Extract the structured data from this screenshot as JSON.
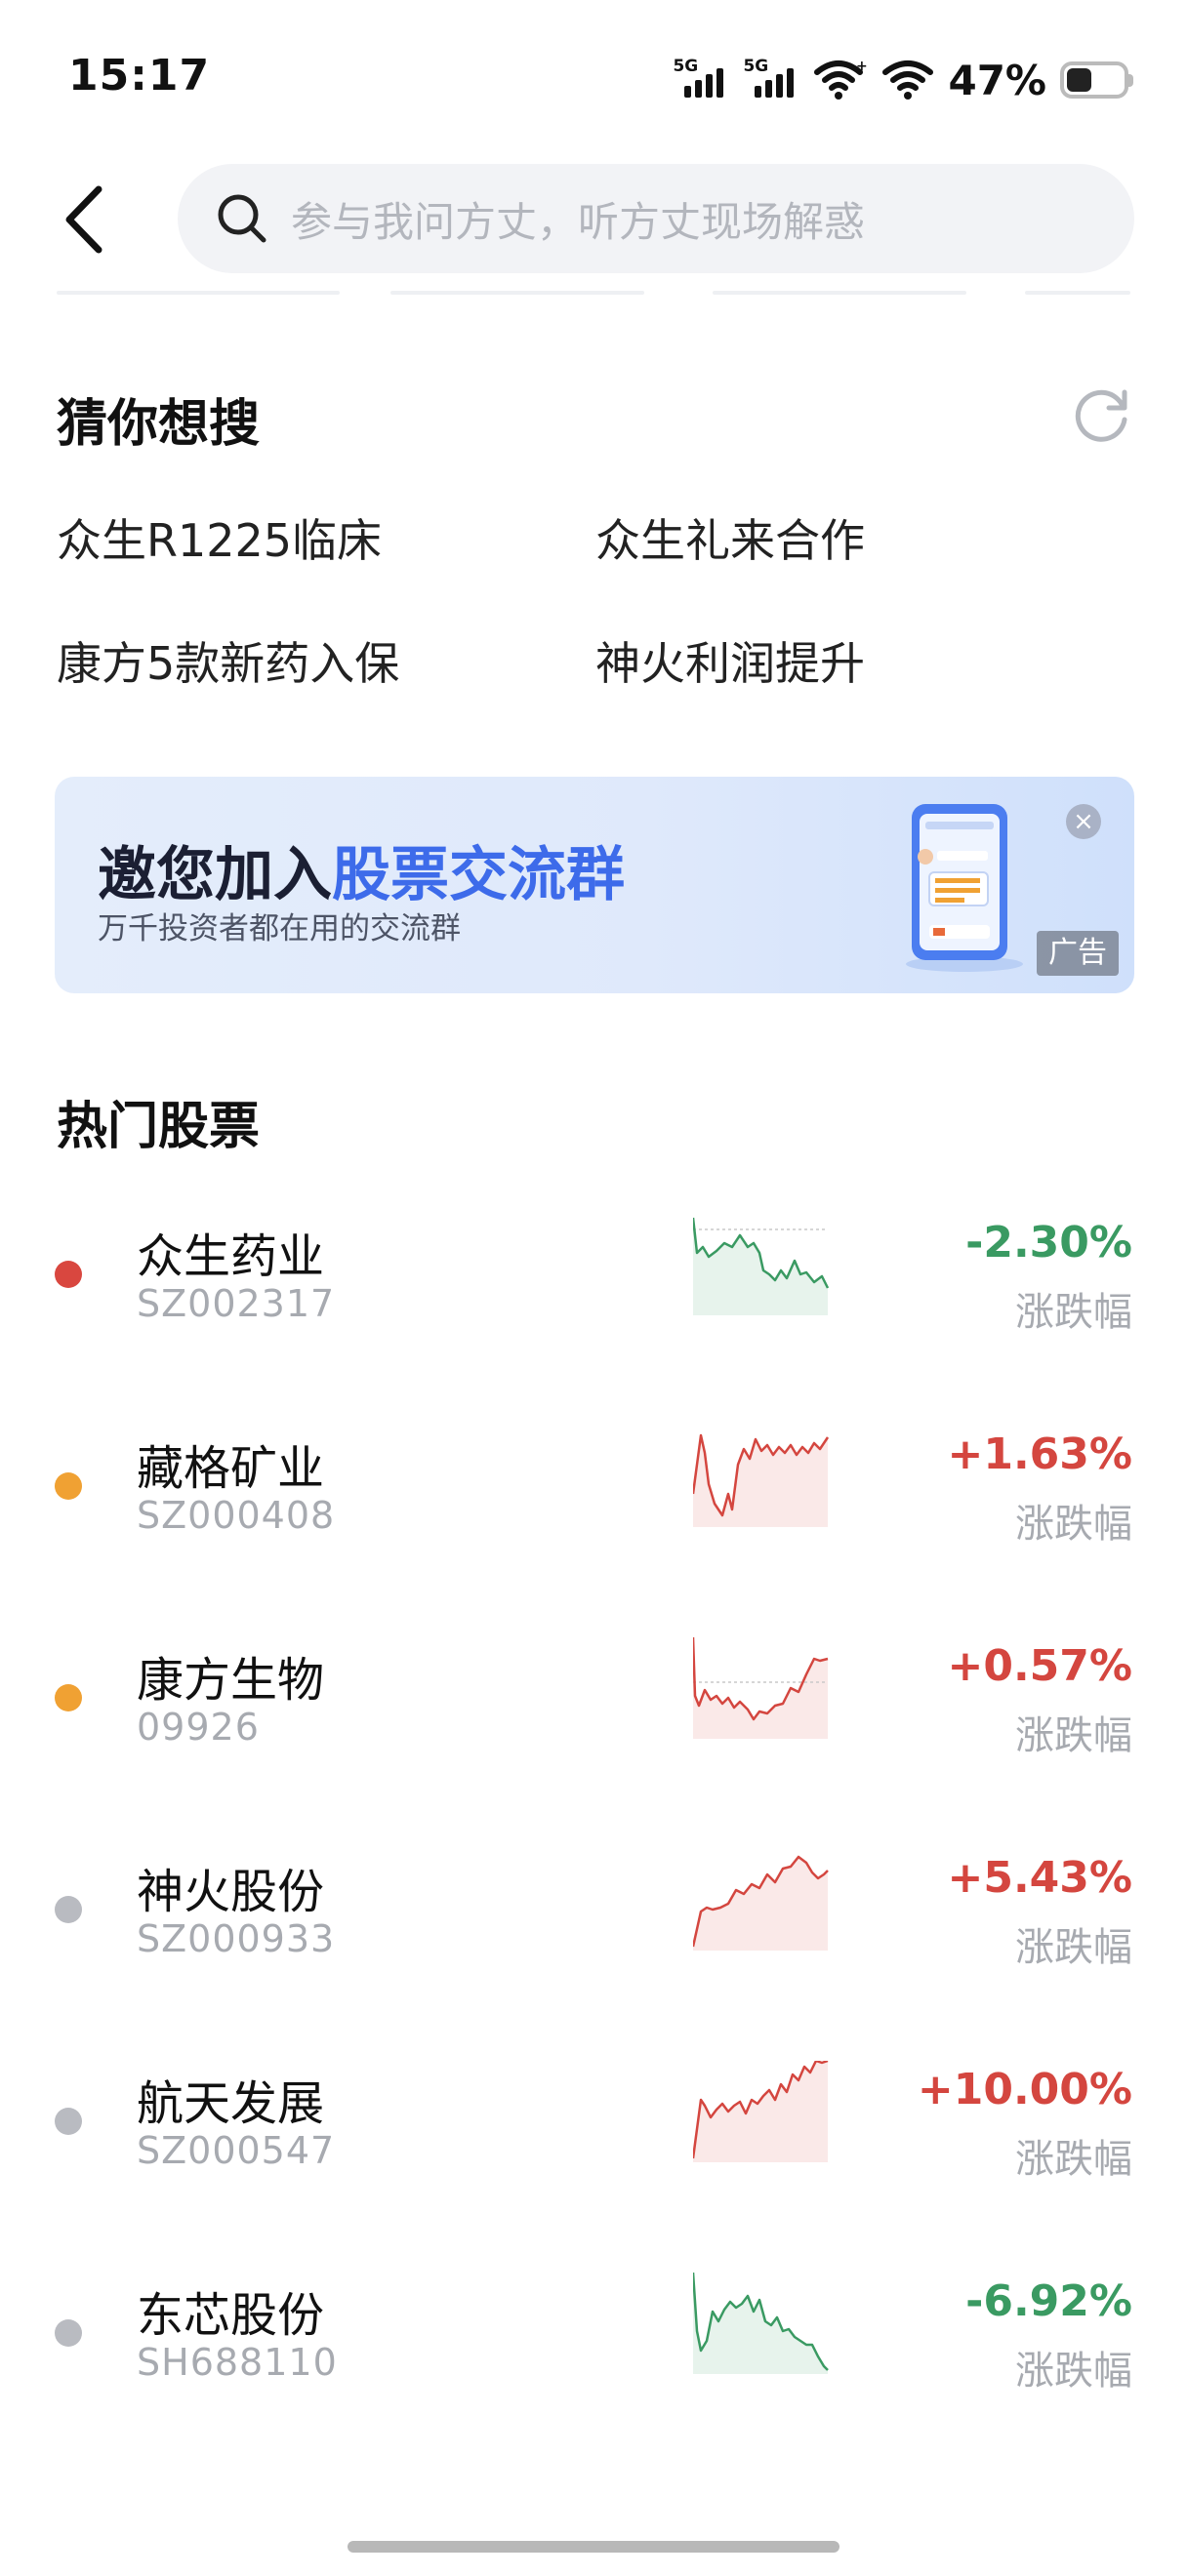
{
  "status_bar": {
    "time": "15:17",
    "network_1": "5G",
    "network_2": "5G",
    "battery_percent": "47%",
    "battery_level": 0.47
  },
  "search": {
    "placeholder": "参与我问方丈，听方丈现场解惑"
  },
  "guess": {
    "title": "猜你想搜",
    "items": [
      "众生R1225临床",
      "众生礼来合作",
      "康方5款新药入保",
      "神火利润提升"
    ]
  },
  "banner": {
    "title_part1": "邀您加入",
    "title_part2": "股票交流群",
    "subtitle": "万千投资者都在用的交流群",
    "ad_label": "广告"
  },
  "hot_stocks": {
    "title": "热门股票",
    "change_label": "涨跌幅",
    "items": [
      {
        "name": "众生药业",
        "code": "SZ002317",
        "change": "-2.30%",
        "direction": "down",
        "dot_color": "#d9473f"
      },
      {
        "name": "藏格矿业",
        "code": "SZ000408",
        "change": "+1.63%",
        "direction": "up",
        "dot_color": "#f0a133"
      },
      {
        "name": "康方生物",
        "code": "09926",
        "change": "+0.57%",
        "direction": "up",
        "dot_color": "#f0a133"
      },
      {
        "name": "神火股份",
        "code": "SZ000933",
        "change": "+5.43%",
        "direction": "up",
        "dot_color": "#b9bbc1"
      },
      {
        "name": "航天发展",
        "code": "SZ000547",
        "change": "+10.00%",
        "direction": "up",
        "dot_color": "#b9bbc1"
      },
      {
        "name": "东芯股份",
        "code": "SH688110",
        "change": "-6.92%",
        "direction": "down",
        "dot_color": "#b9bbc1"
      }
    ]
  },
  "colors": {
    "up": "#d4463f",
    "down": "#3a9a62",
    "accent": "#3d6bea"
  }
}
